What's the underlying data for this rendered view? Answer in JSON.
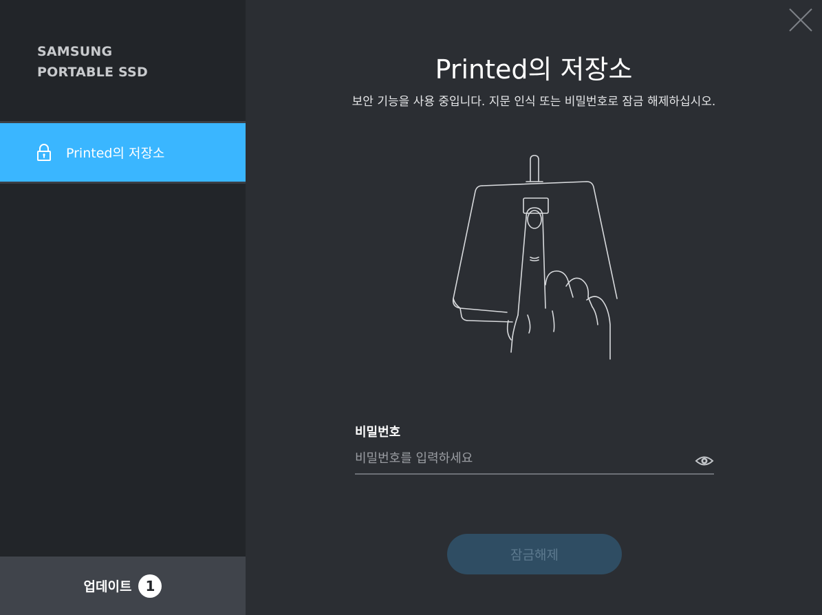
{
  "sidebar": {
    "brand_line1": "SAMSUNG",
    "brand_line2": "PORTABLE SSD",
    "active_item": {
      "label": "Printed의 저장소",
      "icon": "lock-icon"
    },
    "update": {
      "label": "업데이트",
      "badge": "1"
    }
  },
  "main": {
    "title": "Printed의 저장소",
    "subtitle": "보안 기능을 사용 중입니다. 지문 인식 또는 비밀번호로 잠금 해제하십시오.",
    "illustration_icon": "fingerprint-touch-icon",
    "password": {
      "label": "비밀번호",
      "placeholder": "비밀번호를 입력하세요",
      "value": ""
    },
    "unlock_button": "잠금해제",
    "close_icon": "close-icon",
    "show_password_icon": "eye-icon"
  },
  "colors": {
    "accent": "#3ab6ff",
    "sidebar_bg": "#222529",
    "main_bg": "#2b2e33",
    "button_disabled_bg": "#2f4d63",
    "button_disabled_text": "#5d7a8f"
  }
}
